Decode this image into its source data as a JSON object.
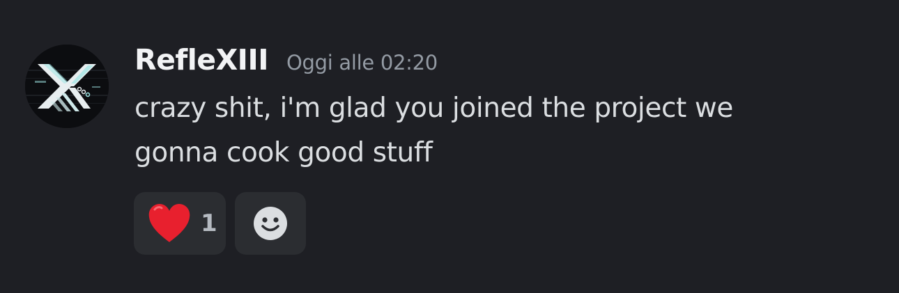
{
  "message": {
    "author": "RefleXIII",
    "timestamp": "Oggi alle 02:20",
    "content_lines": [
      "crazy shit, i'm glad you joined the project we",
      "gonna cook good stuff"
    ]
  },
  "reactions": [
    {
      "emoji": "red-heart-icon",
      "count": "1"
    },
    {
      "emoji": "add-reaction-smiley-icon"
    }
  ],
  "colors": {
    "background": "#1e1f24",
    "username": "#f2f3f5",
    "timestamp": "#949ba4",
    "text": "#dbdee1",
    "reaction_bg": "#2b2d31",
    "heart": "#e8202e"
  }
}
